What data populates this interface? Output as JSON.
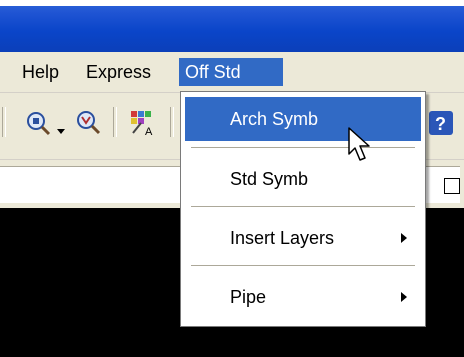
{
  "menubar": {
    "items": [
      {
        "label": "Help"
      },
      {
        "label": "Express"
      },
      {
        "label": "Off Std"
      }
    ]
  },
  "toolbar": {
    "icons": [
      "zoom-icon",
      "zoom-realtime-icon",
      "text-style-icon",
      "help-icon"
    ]
  },
  "dropdown": {
    "items": [
      {
        "label": "Arch Symb",
        "highlighted": true,
        "submenu": false
      },
      {
        "label": "Std Symb",
        "highlighted": false,
        "submenu": false
      },
      {
        "label": "Insert Layers",
        "highlighted": false,
        "submenu": true
      },
      {
        "label": "Pipe",
        "highlighted": false,
        "submenu": true
      }
    ]
  },
  "colors": {
    "titlebar": "#0a45c9",
    "menu_highlight": "#316ac5",
    "chrome": "#ece9d8",
    "canvas": "#000000"
  }
}
